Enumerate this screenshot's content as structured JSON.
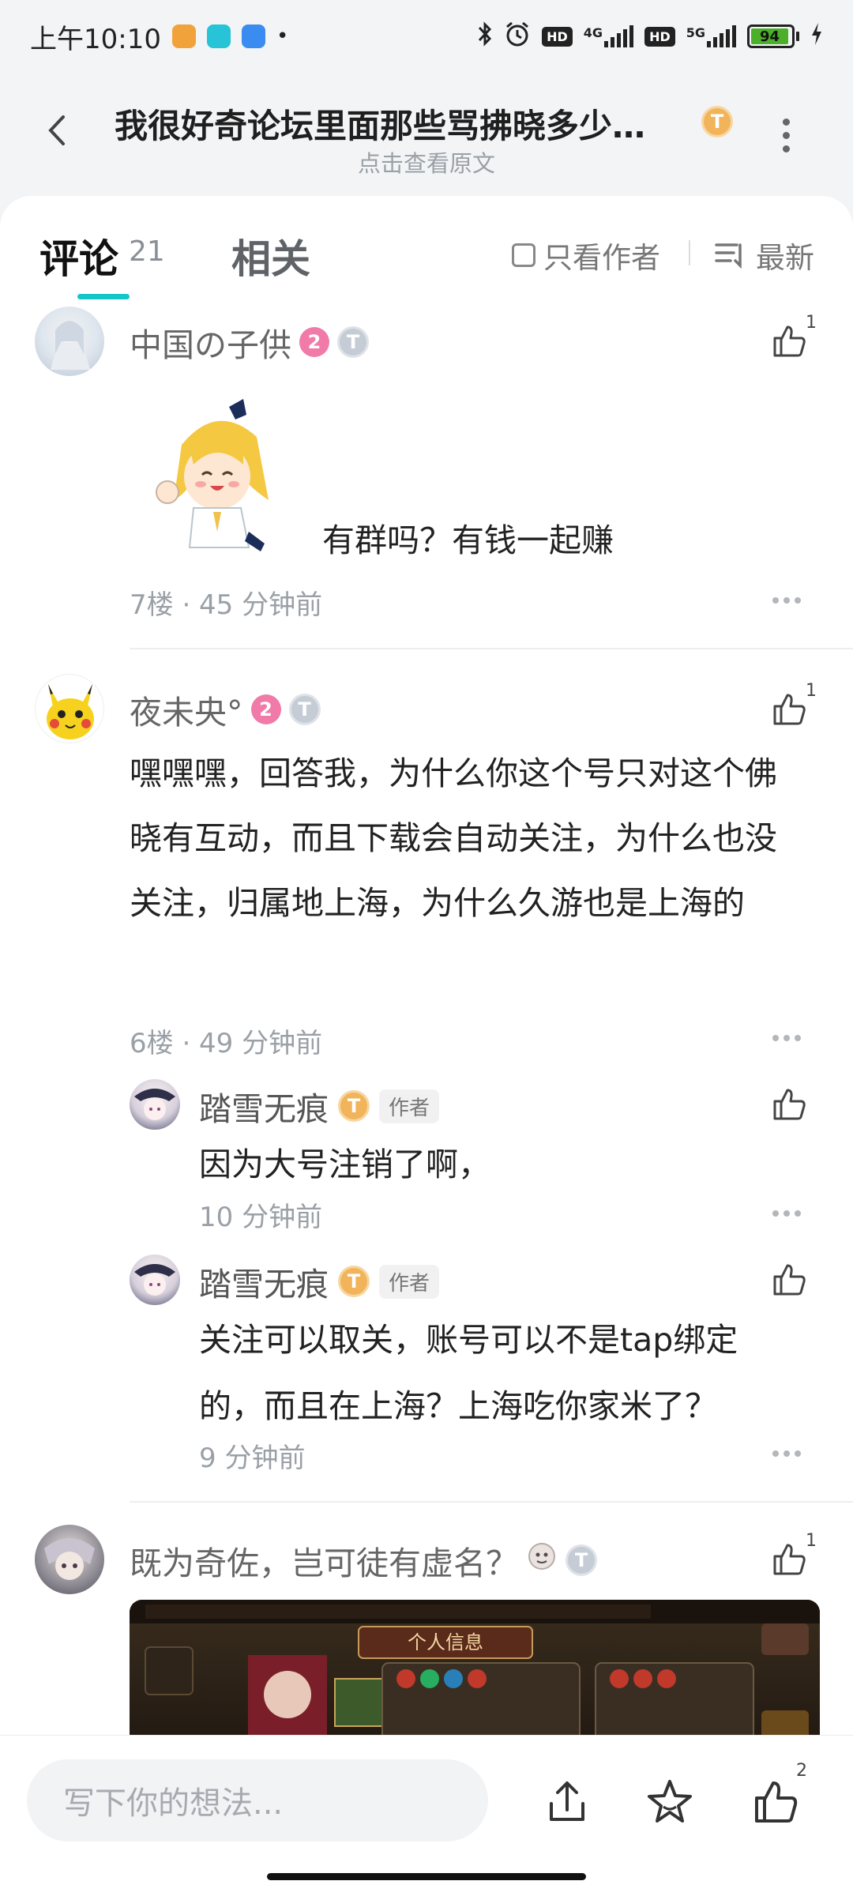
{
  "status_bar": {
    "time": "上午10:10",
    "network_1": "4G",
    "network_2": "5G",
    "hd_1": "HD",
    "hd_2": "HD",
    "battery": "94"
  },
  "header": {
    "title": "我很好奇论坛里面那些骂拂晓多少…",
    "subtitle": "点击查看原文",
    "title_badge": "T"
  },
  "tabs": {
    "comments_label": "评论",
    "comments_count": "21",
    "related_label": "相关",
    "author_only_label": "只看作者",
    "sort_label": "最新"
  },
  "comments": [
    {
      "username": "中国の子供",
      "level": "2",
      "badge": "T",
      "text": "有群吗？有钱一起赚",
      "meta": "7楼 · 45 分钟前",
      "likes": "1"
    },
    {
      "username": "夜未央°",
      "level": "2",
      "badge": "T",
      "text": "嘿嘿嘿，回答我，为什么你这个号只对这个佛晓有互动，而且下载会自动关注，为什么也没关注，归属地上海，为什么久游也是上海的",
      "meta": "6楼 · 49 分钟前",
      "likes": "1",
      "replies": [
        {
          "username": "踏雪无痕",
          "badge": "T",
          "author_tag": "作者",
          "text": "因为大号注销了啊，",
          "meta": "10 分钟前"
        },
        {
          "username": "踏雪无痕",
          "badge": "T",
          "author_tag": "作者",
          "text": "关注可以取关，账号可以不是tap绑定的，而且在上海？上海吃你家米了？",
          "meta": "9 分钟前"
        }
      ]
    },
    {
      "username": "既为奇佐，岂可徒有虚名？",
      "badge": "T",
      "likes": "1",
      "image_caption": "个人信息"
    }
  ],
  "bottom_bar": {
    "input_placeholder": "写下你的想法...",
    "like_count": "2"
  },
  "colors": {
    "accent": "#15c5c8",
    "level_badge": "#f07aa8",
    "gold_badge": "#f2b45a"
  }
}
